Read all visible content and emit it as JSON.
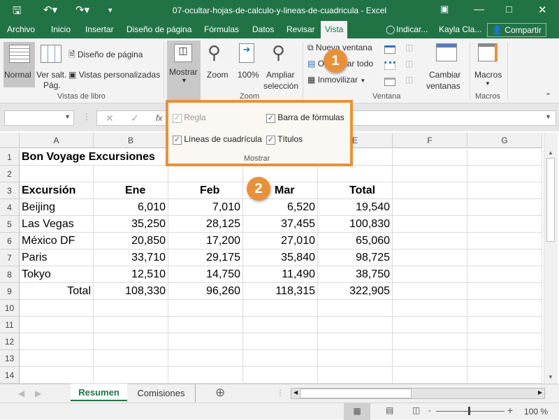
{
  "window": {
    "title": "07-ocultar-hojas-de-calculo-y-lineas-de-cuadricula  -  Excel",
    "user": "Kayla Cla...",
    "share": "Compartir",
    "tell_me": "Indicar..."
  },
  "tabs": [
    "Archivo",
    "Inicio",
    "Insertar",
    "Diseño de página",
    "Fórmulas",
    "Datos",
    "Revisar",
    "Vista"
  ],
  "active_tab": "Vista",
  "ribbon": {
    "normal": "Normal",
    "ver_salt_1": "Ver salt.",
    "ver_salt_2": "Pág.",
    "diseno": "Diseño de página",
    "vistas_pers": "Vistas personalizadas",
    "grp_vistas": "Vistas de libro",
    "mostrar": "Mostrar",
    "zoom": "Zoom",
    "z100": "100%",
    "ampliar_1": "Ampliar",
    "ampliar_2": "selección",
    "grp_zoom": "Zoom",
    "nueva": "Nueva ventana",
    "organizar": "Organizar todo",
    "inmovilizar": "Inmovilizar",
    "cambiar_1": "Cambiar",
    "cambiar_2": "ventanas",
    "grp_ventana": "Ventana",
    "macros": "Macros",
    "grp_macros": "Macros"
  },
  "mostrar_popup": {
    "regla": "Regla",
    "regla_checked": true,
    "regla_disabled": true,
    "barra": "Barra de fórmulas",
    "barra_checked": true,
    "lineas": "Líneas de cuadrícula",
    "lineas_checked": true,
    "titulos": "Títulos",
    "titulos_checked": true,
    "group": "Mostrar"
  },
  "callouts": [
    "1",
    "2"
  ],
  "formula_bar": {
    "fx": "fx",
    "name_box": "",
    "value": ""
  },
  "columns": [
    "A",
    "B",
    "C",
    "D",
    "E",
    "F",
    "G"
  ],
  "rows": [
    "1",
    "2",
    "3",
    "4",
    "5",
    "6",
    "7",
    "8",
    "9",
    "10",
    "11",
    "12",
    "13",
    "14"
  ],
  "sheet": {
    "title": "Bon Voyage Excursiones",
    "headers": [
      "Excursión",
      "Ene",
      "Feb",
      "Mar",
      "Total"
    ],
    "data": [
      [
        "Beijing",
        "6,010",
        "7,010",
        "6,520",
        "19,540"
      ],
      [
        "Las Vegas",
        "35,250",
        "28,125",
        "37,455",
        "100,830"
      ],
      [
        "México DF",
        "20,850",
        "17,200",
        "27,010",
        "65,060"
      ],
      [
        "Paris",
        "33,710",
        "29,175",
        "35,840",
        "98,725"
      ],
      [
        "Tokyo",
        "12,510",
        "14,750",
        "11,490",
        "38,750"
      ]
    ],
    "total": [
      "Total",
      "108,330",
      "96,260",
      "118,315",
      "322,905"
    ]
  },
  "sheet_tabs": [
    "Resumen",
    "Comisiones"
  ],
  "active_sheet": "Resumen",
  "status": {
    "zoom": "100 %",
    "zoom_level": 100
  },
  "colors": {
    "excel_green": "#217346",
    "callout_orange": "#e8913a"
  }
}
